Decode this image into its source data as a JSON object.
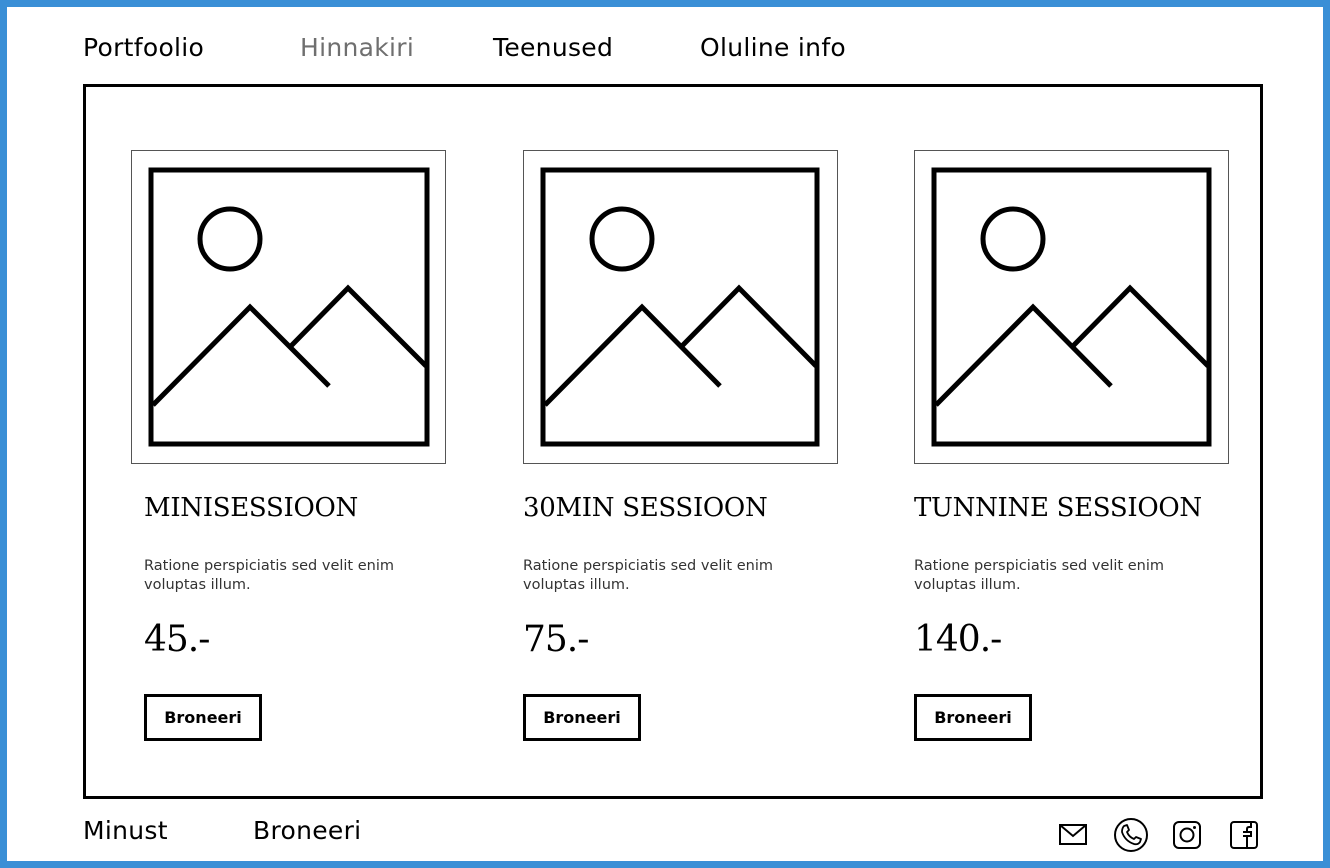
{
  "nav": {
    "items": [
      {
        "label": "Portfoolio"
      },
      {
        "label": "Hinnakiri"
      },
      {
        "label": "Teenused"
      },
      {
        "label": "Oluline info"
      }
    ],
    "active": "Hinnakiri"
  },
  "cards": [
    {
      "title": "MINISESSIOON",
      "description": "Ratione perspiciatis sed velit enim voluptas illum.",
      "price": "45.-",
      "button": "Broneeri",
      "image_icon": "image-placeholder-icon"
    },
    {
      "title": "30MIN SESSIOON",
      "description": "Ratione perspiciatis sed velit enim voluptas illum.",
      "price": "75.-",
      "button": "Broneeri",
      "image_icon": "image-placeholder-icon"
    },
    {
      "title": "TUNNINE SESSIOON",
      "description": "Ratione perspiciatis sed velit enim voluptas illum.",
      "price": "140.-",
      "button": "Broneeri",
      "image_icon": "image-placeholder-icon"
    }
  ],
  "footer": {
    "links": [
      {
        "label": "Minust"
      },
      {
        "label": "Broneeri"
      }
    ],
    "social_icons": [
      "mail-icon",
      "phone-icon",
      "instagram-icon",
      "facebook-icon"
    ]
  },
  "colors": {
    "frame_border": "#3a8fd6",
    "active_nav": "#6f6f6f",
    "ink": "#000000"
  }
}
